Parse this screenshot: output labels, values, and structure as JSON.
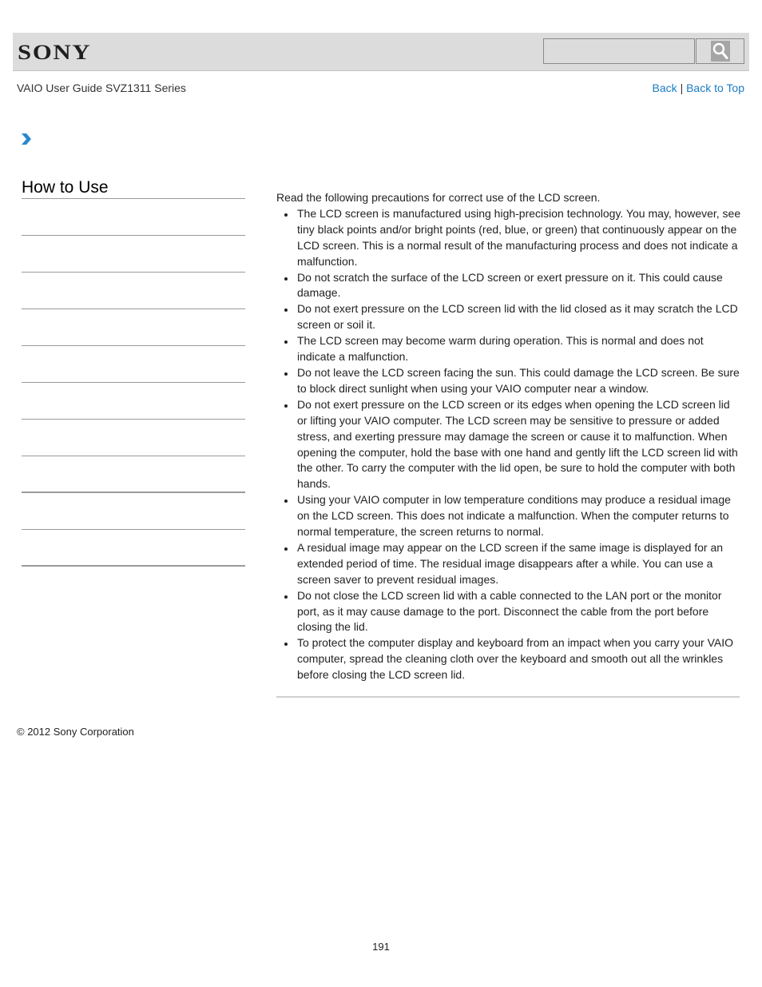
{
  "header": {
    "logo_text": "SONY",
    "search": {
      "placeholder": "",
      "value": ""
    },
    "search_button_icon": "magnifier-icon"
  },
  "subheader": {
    "guide_title": "VAIO User Guide SVZ1311 Series",
    "back_label": "Back",
    "separator": "|",
    "back_to_top_label": "Back to Top"
  },
  "breadcrumb": {
    "icon": "chevron-right-icon",
    "color": "#1a7bc4"
  },
  "sidebar": {
    "heading": "How to Use",
    "items": [
      {
        "label": ""
      },
      {
        "label": ""
      },
      {
        "label": ""
      },
      {
        "label": ""
      },
      {
        "label": ""
      },
      {
        "label": ""
      },
      {
        "label": ""
      },
      {
        "label": ""
      },
      {
        "label": ""
      },
      {
        "label": ""
      }
    ]
  },
  "content": {
    "intro": "Read the following precautions for correct use of the LCD screen.",
    "bullets": [
      "The LCD screen is manufactured using high-precision technology. You may, however, see tiny black points and/or bright points (red, blue, or green) that continuously appear on the LCD screen. This is a normal result of the manufacturing process and does not indicate a malfunction.",
      "Do not scratch the surface of the LCD screen or exert pressure on it. This could cause damage.",
      "Do not exert pressure on the LCD screen lid with the lid closed as it may scratch the LCD screen or soil it.",
      "The LCD screen may become warm during operation. This is normal and does not indicate a malfunction.",
      "Do not leave the LCD screen facing the sun. This could damage the LCD screen. Be sure to block direct sunlight when using your VAIO computer near a window.",
      "Do not exert pressure on the LCD screen or its edges when opening the LCD screen lid or lifting your VAIO computer. The LCD screen may be sensitive to pressure or added stress, and exerting pressure may damage the screen or cause it to malfunction. When opening the computer, hold the base with one hand and gently lift the LCD screen lid with the other. To carry the computer with the lid open, be sure to hold the computer with both hands.",
      "Using your VAIO computer in low temperature conditions may produce a residual image on the LCD screen. This does not indicate a malfunction. When the computer returns to normal temperature, the screen returns to normal.",
      "A residual image may appear on the LCD screen if the same image is displayed for an extended period of time. The residual image disappears after a while. You can use a screen saver to prevent residual images.",
      "Do not close the LCD screen lid with a cable connected to the LAN port or the monitor port, as it may cause damage to the port. Disconnect the cable from the port before closing the lid.",
      "To protect the computer display and keyboard from an impact when you carry your VAIO computer, spread the cleaning cloth over the keyboard and smooth out all the wrinkles before closing the LCD screen lid."
    ]
  },
  "footer": {
    "copyright": "© 2012 Sony Corporation",
    "page_number": "191"
  },
  "colors": {
    "link": "#1a7bc4",
    "header_bg": "#dcdcdc",
    "divider": "#9a9a9a"
  }
}
